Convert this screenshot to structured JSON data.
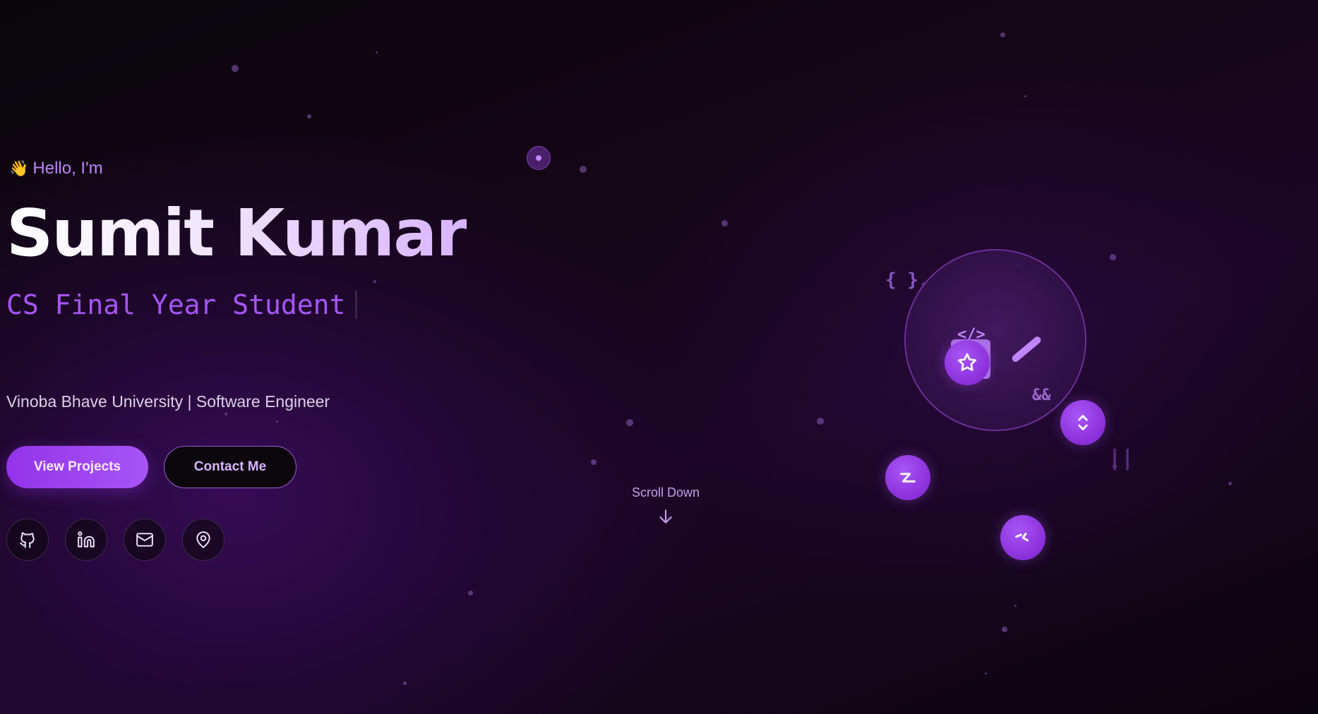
{
  "hero": {
    "greeting_emoji": "👋",
    "greeting": "Hello, I'm",
    "name": "Sumit Kumar",
    "role": "CS Final Year Student",
    "subtitle": "Vinoba Bhave University | Software Engineer"
  },
  "buttons": {
    "primary": "View Projects",
    "secondary": "Contact Me"
  },
  "social": [
    {
      "icon": "github-icon"
    },
    {
      "icon": "linkedin-icon"
    },
    {
      "icon": "mail-icon"
    },
    {
      "icon": "map-pin-icon"
    }
  ],
  "scroll": {
    "label": "Scroll Down",
    "icon": "arrow-down-icon"
  },
  "decor": {
    "braces": "{ }",
    "code_tag": "</>",
    "and_op": "&&",
    "or_op": "||",
    "node_icons": [
      "star-icon",
      "lightning-icon",
      "refresh-icon",
      "slash-icon"
    ]
  },
  "colors": {
    "accent": "#a855f7",
    "accent_dark": "#9333ea",
    "text_light": "#ddd0e8",
    "background": "#0b060c"
  }
}
